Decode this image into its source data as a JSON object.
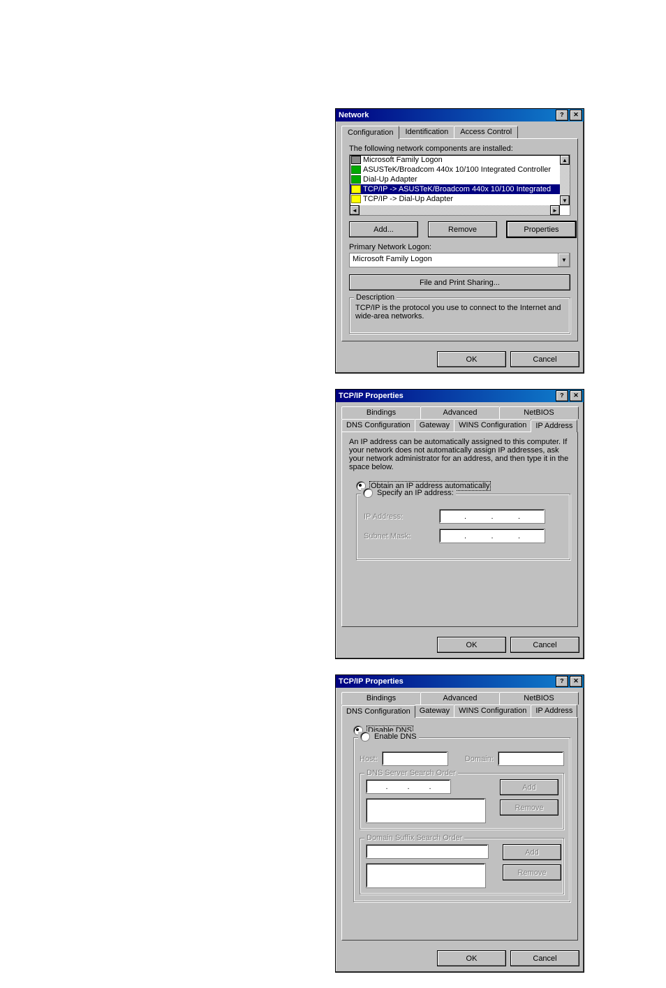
{
  "dlg1": {
    "title": "Network",
    "help": "?",
    "close": "✕",
    "tabs": {
      "config": "Configuration",
      "ident": "Identification",
      "access": "Access Control"
    },
    "components_heading": "The following network components are installed:",
    "components": [
      "Microsoft Family Logon",
      "ASUSTeK/Broadcom 440x 10/100 Integrated Controller",
      "Dial-Up Adapter",
      "TCP/IP -> ASUSTeK/Broadcom 440x 10/100 Integrated",
      "TCP/IP -> Dial-Up Adapter"
    ],
    "add": "Add...",
    "remove": "Remove",
    "properties": "Properties",
    "primary_logon_label": "Primary Network Logon:",
    "primary_logon_value": "Microsoft Family Logon",
    "file_print": "File and Print Sharing...",
    "desc_legend": "Description",
    "desc_text": "TCP/IP is the protocol you use to connect to the Internet and wide-area networks.",
    "ok": "OK",
    "cancel": "Cancel"
  },
  "dlg2": {
    "title": "TCP/IP Properties",
    "help": "?",
    "close": "✕",
    "tabs_top": {
      "bindings": "Bindings",
      "advanced": "Advanced",
      "netbios": "NetBIOS"
    },
    "tabs_bottom": {
      "dns": "DNS Configuration",
      "gateway": "Gateway",
      "wins": "WINS Configuration",
      "ip": "IP Address"
    },
    "blurb": "An IP address can be automatically assigned to this computer. If your network does not automatically assign IP addresses, ask your network administrator for an address, and then type it in the space below.",
    "obtain": "Obtain an IP address automatically",
    "specify": "Specify an IP address:",
    "ipaddr_label": "IP Address:",
    "subnet_label": "Subnet Mask:",
    "ok": "OK",
    "cancel": "Cancel"
  },
  "dlg3": {
    "title": "TCP/IP Properties",
    "help": "?",
    "close": "✕",
    "tabs_top": {
      "bindings": "Bindings",
      "advanced": "Advanced",
      "netbios": "NetBIOS"
    },
    "tabs_bottom": {
      "dns": "DNS Configuration",
      "gateway": "Gateway",
      "wins": "WINS Configuration",
      "ip": "IP Address"
    },
    "disable": "Disable DNS",
    "enable": "Enable DNS",
    "host": "Host:",
    "domain": "Domain:",
    "dns_order": "DNS Server Search Order",
    "suffix_order": "Domain Suffix Search Order",
    "add": "Add",
    "remove": "Remove",
    "ok": "OK",
    "cancel": "Cancel"
  }
}
